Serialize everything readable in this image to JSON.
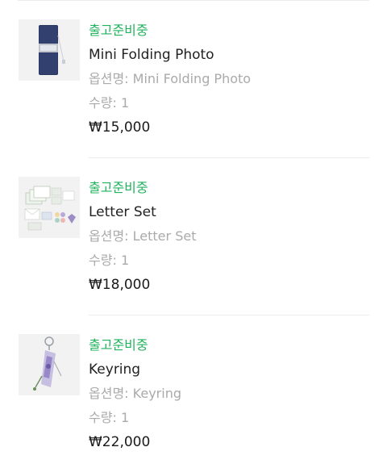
{
  "order_items": [
    {
      "thumbnail": "folding-photo-thumbnail",
      "status": "출고준비중",
      "name": "Mini Folding Photo",
      "option_label": "옵션명:",
      "option_value": "Mini Folding Photo",
      "qty_label": "수량:",
      "qty_value": "1",
      "price": "₩15,000"
    },
    {
      "thumbnail": "letter-set-thumbnail",
      "status": "출고준비중",
      "name": "Letter Set",
      "option_label": "옵션명:",
      "option_value": "Letter Set",
      "qty_label": "수량:",
      "qty_value": "1",
      "price": "₩18,000"
    },
    {
      "thumbnail": "keyring-thumbnail",
      "status": "출고준비중",
      "name": "Keyring",
      "option_label": "옵션명:",
      "option_value": "Keyring",
      "qty_label": "수량:",
      "qty_value": "1",
      "price": "₩22,000"
    }
  ],
  "colors": {
    "status_green": "#20b35c",
    "muted_text": "#aaaaaa",
    "primary_text": "#222222",
    "divider": "#ececec",
    "thumbnail_bg": "#f1f1f1"
  }
}
